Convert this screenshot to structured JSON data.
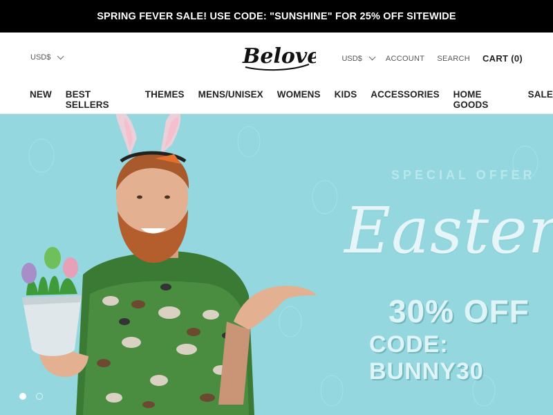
{
  "announcement": {
    "text": "SPRING FEVER SALE! USE CODE: \"SUNSHINE\" FOR 25% OFF SITEWIDE"
  },
  "header": {
    "currency_left": "USD$",
    "logo_text": "Beloved",
    "currency_right": "USD$",
    "account": "ACCOUNT",
    "search": "SEARCH",
    "cart": "CART (0)"
  },
  "nav": {
    "items": [
      "NEW",
      "BEST SELLERS",
      "THEMES",
      "MENS/UNISEX",
      "WOMENS",
      "KIDS",
      "ACCESSORIES",
      "HOME GOODS",
      "SALE"
    ]
  },
  "hero": {
    "offer": "SPECIAL OFFER",
    "title": "Easter",
    "discount": "30% OFF",
    "code": "CODE: BUNNY30",
    "active_slide": 1,
    "slide_count": 2
  },
  "colors": {
    "announcement_bg": "#000000",
    "hero_bg": "#94d7df",
    "text_dark": "#222222"
  },
  "icons": [
    "chevron-down-icon",
    "chevron-down-icon"
  ]
}
